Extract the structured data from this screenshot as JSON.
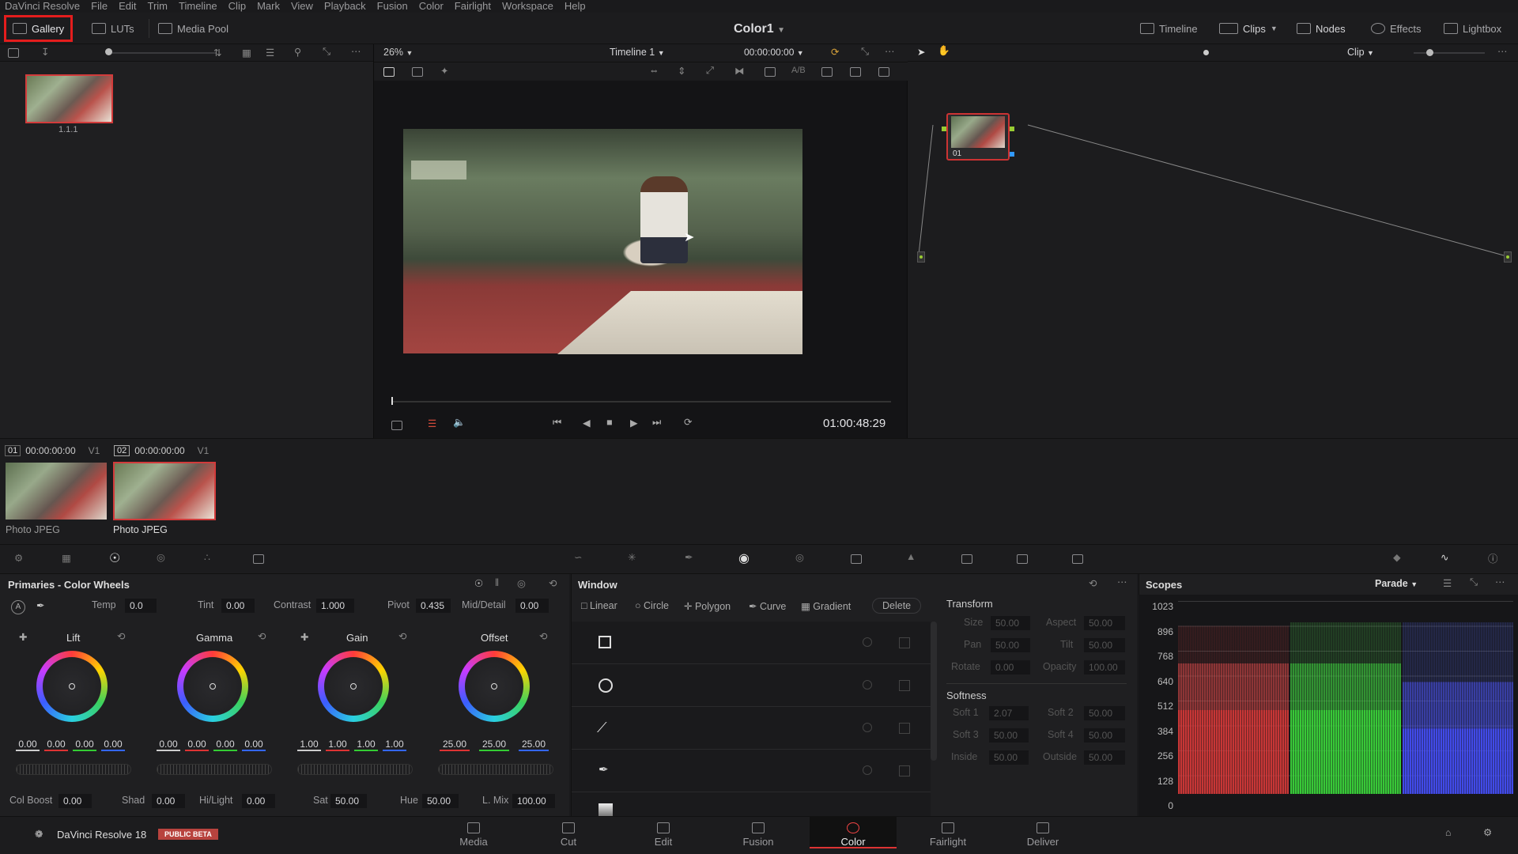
{
  "menu": [
    "DaVinci Resolve",
    "File",
    "Edit",
    "Trim",
    "Timeline",
    "Clip",
    "Mark",
    "View",
    "Playback",
    "Fusion",
    "Color",
    "Fairlight",
    "Workspace",
    "Help"
  ],
  "topbar": {
    "gallery": "Gallery",
    "luts": "LUTs",
    "media_pool": "Media Pool",
    "project_title": "Color1",
    "timeline": "Timeline",
    "clips": "Clips",
    "nodes": "Nodes",
    "effects": "Effects",
    "lightbox": "Lightbox"
  },
  "gallery": {
    "still_label": "1.1.1"
  },
  "viewer": {
    "zoom": "26%",
    "timeline_name": "Timeline 1",
    "timecode_top": "00:00:00:00",
    "timecode": "01:00:48:29"
  },
  "nodes": {
    "mode": "Clip",
    "node_label": "01"
  },
  "clips": [
    {
      "index": "01",
      "tc": "00:00:00:00",
      "track": "V1",
      "type": "Photo JPEG"
    },
    {
      "index": "02",
      "tc": "00:00:00:00",
      "track": "V1",
      "type": "Photo JPEG"
    }
  ],
  "primaries": {
    "title": "Primaries - Color Wheels",
    "temp_label": "Temp",
    "temp": "0.0",
    "tint_label": "Tint",
    "tint": "0.00",
    "contrast_label": "Contrast",
    "contrast": "1.000",
    "pivot_label": "Pivot",
    "pivot": "0.435",
    "middetail_label": "Mid/Detail",
    "middetail": "0.00",
    "wheels": [
      {
        "name": "Lift",
        "vals": [
          "0.00",
          "0.00",
          "0.00",
          "0.00"
        ]
      },
      {
        "name": "Gamma",
        "vals": [
          "0.00",
          "0.00",
          "0.00",
          "0.00"
        ]
      },
      {
        "name": "Gain",
        "vals": [
          "1.00",
          "1.00",
          "1.00",
          "1.00"
        ]
      },
      {
        "name": "Offset",
        "vals": [
          "25.00",
          "25.00",
          "25.00"
        ]
      }
    ],
    "colboost_label": "Col Boost",
    "colboost": "0.00",
    "shad_label": "Shad",
    "shad": "0.00",
    "hilight_label": "Hi/Light",
    "hilight": "0.00",
    "sat_label": "Sat",
    "sat": "50.00",
    "hue_label": "Hue",
    "hue": "50.00",
    "lmix_label": "L. Mix",
    "lmix": "100.00"
  },
  "window": {
    "title": "Window",
    "linear": "Linear",
    "circle": "Circle",
    "polygon": "Polygon",
    "curve": "Curve",
    "gradient": "Gradient",
    "delete": "Delete",
    "transform": "Transform",
    "size": "Size",
    "size_v": "50.00",
    "aspect": "Aspect",
    "aspect_v": "50.00",
    "pan": "Pan",
    "pan_v": "50.00",
    "tilt": "Tilt",
    "tilt_v": "50.00",
    "rotate": "Rotate",
    "rotate_v": "0.00",
    "opacity": "Opacity",
    "opacity_v": "100.00",
    "softness": "Softness",
    "soft1": "Soft 1",
    "soft1_v": "2.07",
    "soft2": "Soft 2",
    "soft2_v": "50.00",
    "soft3": "Soft 3",
    "soft3_v": "50.00",
    "soft4": "Soft 4",
    "soft4_v": "50.00",
    "inside": "Inside",
    "inside_v": "50.00",
    "outside": "Outside",
    "outside_v": "50.00"
  },
  "scopes": {
    "title": "Scopes",
    "mode": "Parade",
    "ticks": [
      "1023",
      "896",
      "768",
      "640",
      "512",
      "384",
      "256",
      "128",
      "0"
    ]
  },
  "bottom": {
    "app": "DaVinci Resolve 18",
    "badge": "PUBLIC BETA",
    "pages": [
      "Media",
      "Cut",
      "Edit",
      "Fusion",
      "Color",
      "Fairlight",
      "Deliver"
    ],
    "active": "Color"
  }
}
